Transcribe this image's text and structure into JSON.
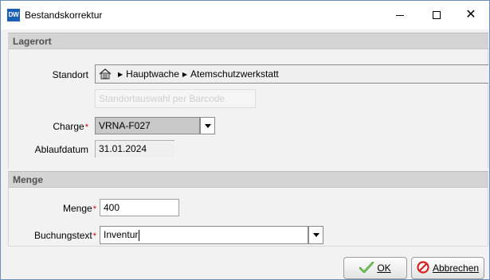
{
  "window": {
    "logo": "DW",
    "title": "Bestandskorrektur"
  },
  "lagerort": {
    "header": "Lagerort",
    "standort_label": "Standort",
    "path": [
      "Hauptwache",
      "Atemschutzwerkstatt"
    ],
    "barcode_placeholder": "Standortauswahl per Barcode",
    "charge_label": "Charge",
    "charge_value": "VRNA-F027",
    "ablauf_label": "Ablaufdatum",
    "ablauf_value": "31.01.2024"
  },
  "menge": {
    "header": "Menge",
    "menge_label": "Menge",
    "menge_value": "400",
    "buchung_label": "Buchungstext",
    "buchung_value": "Inventur"
  },
  "required_marker": "*",
  "buttons": {
    "ok_label": "OK",
    "cancel_label": "Abbrechen"
  },
  "colors": {
    "required": "#d00000",
    "logo_bg": "#1a5fb4"
  },
  "icons": {
    "logo": "app-logo-icon",
    "home": "home-icon",
    "ok": "checkmark-icon",
    "cancel": "cancel-icon"
  }
}
